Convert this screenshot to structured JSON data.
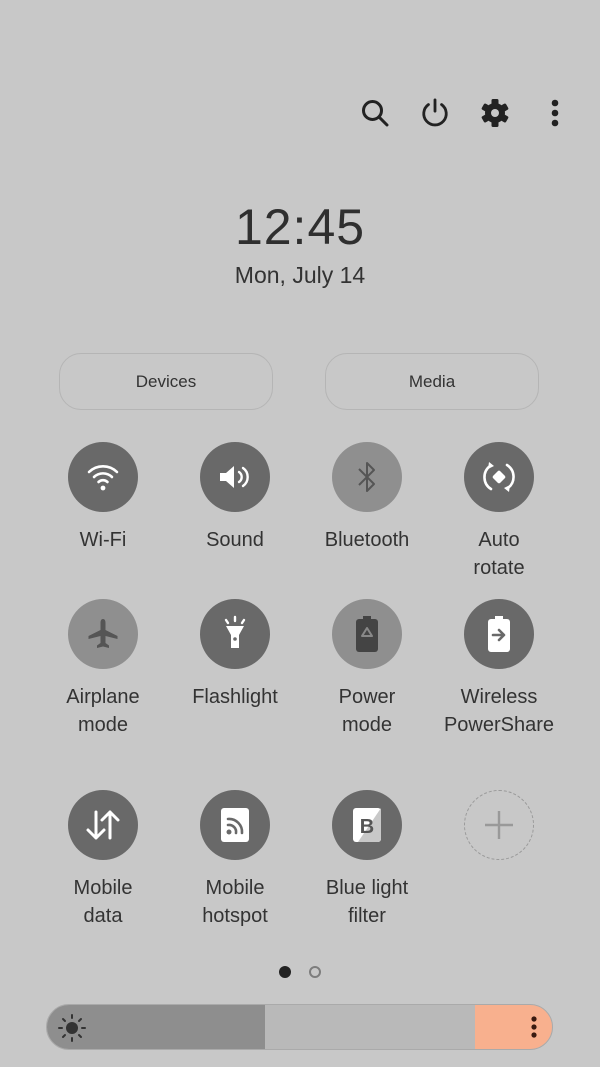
{
  "header": {
    "icons": [
      "search-icon",
      "power-icon",
      "settings-icon",
      "more-options-icon"
    ]
  },
  "clock": {
    "time": "12:45",
    "date": "Mon, July 14"
  },
  "shortcuts": {
    "devices_label": "Devices",
    "media_label": "Media"
  },
  "tiles": [
    {
      "label": "Wi-Fi",
      "icon": "wifi-icon",
      "state": "on"
    },
    {
      "label": "Sound",
      "icon": "sound-icon",
      "state": "on"
    },
    {
      "label": "Bluetooth",
      "icon": "bluetooth-icon",
      "state": "off"
    },
    {
      "label": "Auto\nrotate",
      "icon": "auto-rotate-icon",
      "state": "on"
    },
    {
      "label": "Airplane\nmode",
      "icon": "airplane-icon",
      "state": "off"
    },
    {
      "label": "Flashlight",
      "icon": "flashlight-icon",
      "state": "on"
    },
    {
      "label": "Power\nmode",
      "icon": "power-mode-icon",
      "state": "off"
    },
    {
      "label": "Wireless\nPowerShare",
      "icon": "wireless-powershare-icon",
      "state": "on"
    },
    {
      "label": "Mobile\ndata",
      "icon": "mobile-data-icon",
      "state": "on"
    },
    {
      "label": "Mobile\nhotspot",
      "icon": "mobile-hotspot-icon",
      "state": "on"
    },
    {
      "label": "Blue light\nfilter",
      "icon": "blue-light-filter-icon",
      "state": "on"
    },
    {
      "label": "",
      "icon": "add-icon",
      "state": "add"
    }
  ],
  "pager": {
    "current_page": 1,
    "total_pages": 2
  },
  "brightness": {
    "level": 0.51,
    "accent_color": "#f8b08e"
  }
}
